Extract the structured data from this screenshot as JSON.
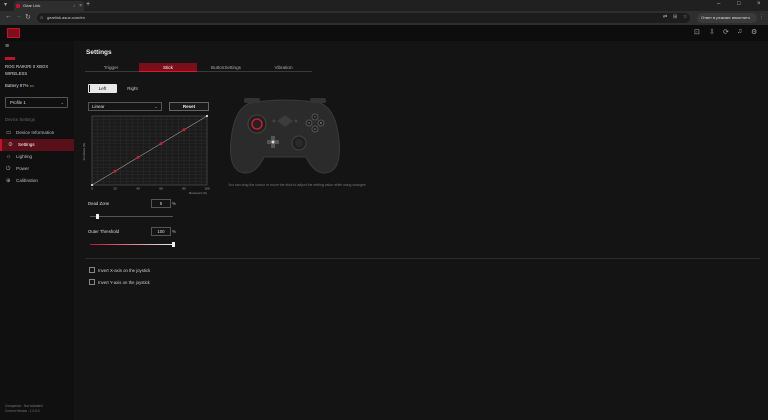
{
  "browser": {
    "tab_title": "Gear Link",
    "url": "gearlink.asus.com/en",
    "incognito_label": "Ответ в режиме инкогнито"
  },
  "sidebar": {
    "device_name_line1": "ROG RAIKIRI II XBOX",
    "device_name_line2": "WIRELESS",
    "battery_label": "Battery 97%",
    "profile": "Profile 1",
    "section_label": "Device Settings",
    "items": [
      {
        "label": "Device Information",
        "icon": "info-icon"
      },
      {
        "label": "Settings",
        "icon": "gear-icon"
      },
      {
        "label": "Lighting",
        "icon": "sun-icon"
      },
      {
        "label": "Power",
        "icon": "power-icon"
      },
      {
        "label": "Calibration",
        "icon": "calibration-icon"
      }
    ],
    "footer_line1": "Companion : Not activated",
    "footer_line2": "Current Version : 1.0.0.0"
  },
  "main": {
    "title": "Settings",
    "tabs": [
      "Trigger",
      "Stick",
      "ButtonSettings",
      "Vibration"
    ],
    "active_tab": "Stick",
    "stick_left": "Left",
    "stick_right": "Right",
    "curve_type": "Linear",
    "reset_label": "Reset",
    "chart_ylabel": "Sensitivity (%)",
    "chart_xlabel": "Movement (%)",
    "dead_zone_label": "Dead Zone",
    "dead_zone_value": "5",
    "outer_threshold_label": "Outer Threshold",
    "outer_threshold_value": "100",
    "percent": "%",
    "invert_x_label": "Invert X-axis on the joystick",
    "invert_y_label": "Invert Y-axis on the joystick",
    "controller_note": "You can drag the cursor or move the stick to adjust the setting value while using changes",
    "accent_color": "#c8102e"
  },
  "chart_data": {
    "type": "line",
    "x": [
      0,
      20,
      40,
      60,
      80,
      100
    ],
    "y": [
      0,
      20,
      40,
      60,
      80,
      100
    ],
    "xticks": [
      "0",
      "20",
      "40",
      "60",
      "80",
      "100"
    ],
    "xlim": [
      0,
      100
    ],
    "ylim": [
      0,
      100
    ],
    "xlabel": "Movement (%)",
    "ylabel": "Sensitivity (%)",
    "grid": true,
    "marker_color": "#e0152f",
    "line_color": "#999999"
  }
}
